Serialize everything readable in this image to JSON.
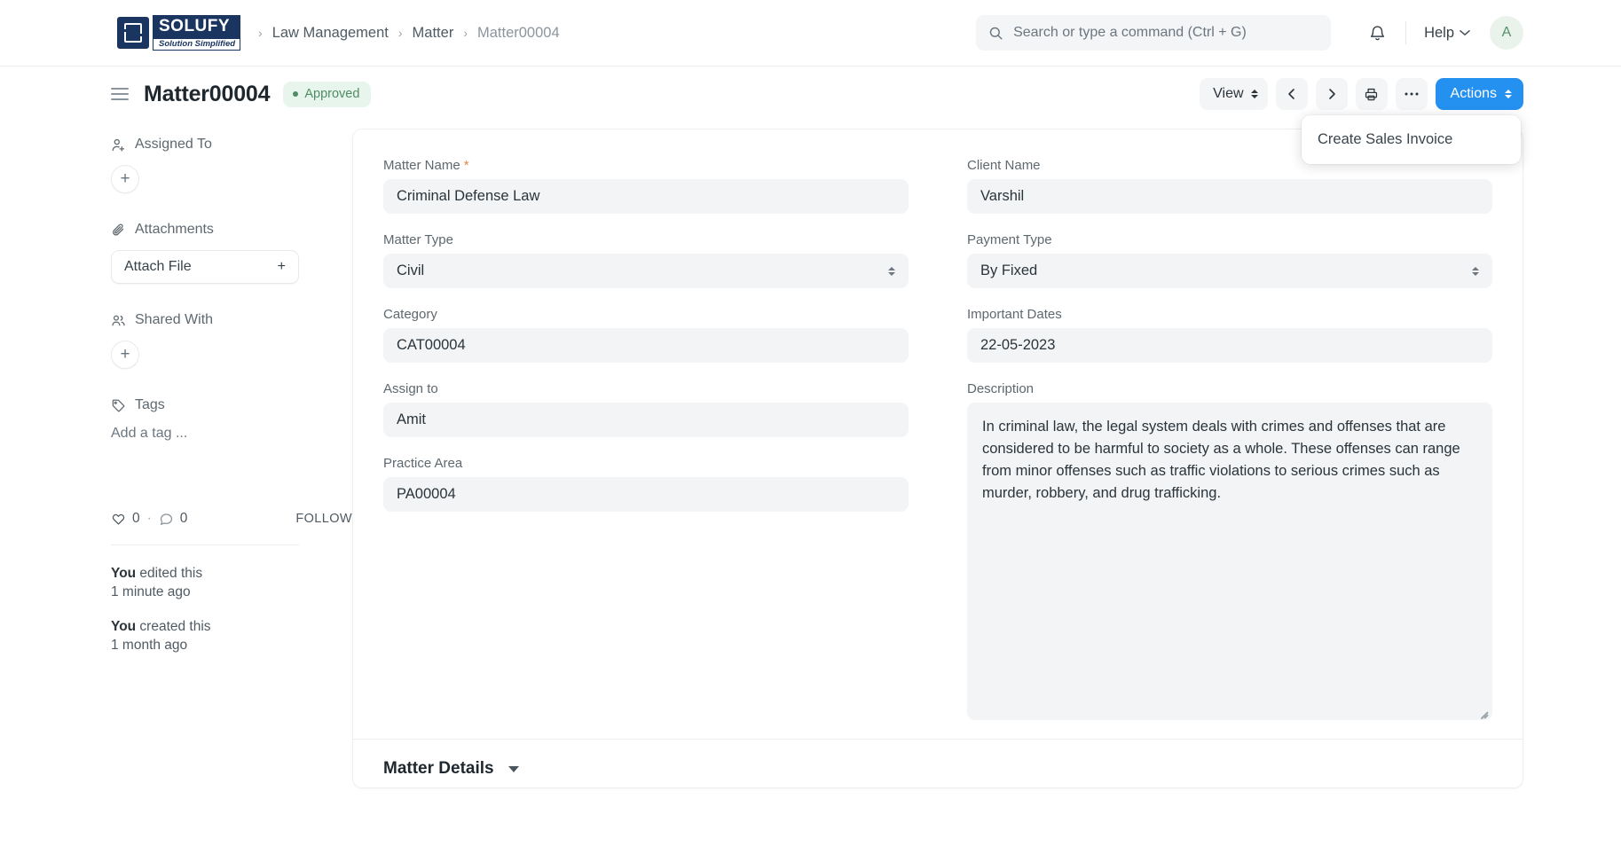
{
  "navbar": {
    "brand": {
      "mark": "S",
      "title": "SOLUFY",
      "tagline": "Solution Simplified"
    },
    "breadcrumb": [
      {
        "label": "Law Management",
        "current": false
      },
      {
        "label": "Matter",
        "current": false
      },
      {
        "label": "Matter00004",
        "current": true
      }
    ],
    "search": {
      "value": "",
      "placeholder": "Search or type a command (Ctrl + G)"
    },
    "help_label": "Help",
    "avatar_initial": "A"
  },
  "page_head": {
    "title": "Matter00004",
    "status_badge": "Approved",
    "view_label": "View",
    "actions_label": "Actions",
    "dropdown": {
      "items": [
        "Create Sales Invoice"
      ]
    }
  },
  "sidebar": {
    "assigned_to": {
      "label": "Assigned To",
      "add": "+"
    },
    "attachments": {
      "label": "Attachments",
      "button_label": "Attach File",
      "add": "+"
    },
    "shared_with": {
      "label": "Shared With",
      "add": "+"
    },
    "tags": {
      "label": "Tags",
      "placeholder": "Add a tag ..."
    },
    "social": {
      "likes": "0",
      "separator": "·",
      "comments": "0",
      "follow_label": "FOLLOW"
    },
    "activity": [
      {
        "actor": "You",
        "action": " edited this",
        "time": "1 minute ago"
      },
      {
        "actor": "You",
        "action": " created this",
        "time": "1 month ago"
      }
    ]
  },
  "form": {
    "left": [
      {
        "label": "Matter Name",
        "required": true,
        "value": "Criminal Defense Law",
        "type": "text"
      },
      {
        "label": "Matter Type",
        "required": false,
        "value": "Civil",
        "type": "select"
      },
      {
        "label": "Category",
        "required": false,
        "value": "CAT00004",
        "type": "text"
      },
      {
        "label": "Assign to",
        "required": false,
        "value": "Amit",
        "type": "text"
      },
      {
        "label": "Practice Area",
        "required": false,
        "value": "PA00004",
        "type": "text"
      }
    ],
    "right": [
      {
        "label": "Client Name",
        "required": false,
        "value": "Varshil",
        "type": "text"
      },
      {
        "label": "Payment Type",
        "required": false,
        "value": "By Fixed",
        "type": "select"
      },
      {
        "label": "Important Dates",
        "required": false,
        "value": "22-05-2023",
        "type": "text"
      }
    ],
    "description": {
      "label": "Description",
      "value": "In criminal law, the legal system deals with crimes and offenses that are considered to be harmful to society as a whole. These offenses can range from minor offenses such as traffic violations to serious crimes such as murder, robbery, and drug trafficking."
    },
    "section": {
      "title": "Matter Details"
    }
  },
  "colors": {
    "primary": "#2490ef",
    "brand_navy": "#1b3561",
    "badge_green_text": "#4e8c63",
    "badge_green_bg": "#e8f5ec",
    "required_orange": "#e08a4c",
    "field_bg": "#f2f4f5"
  }
}
